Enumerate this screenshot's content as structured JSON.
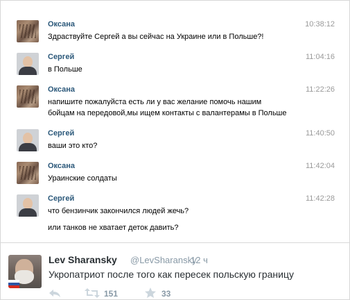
{
  "messages": [
    {
      "sender": "Оксана",
      "time": "10:38:12",
      "lines": [
        "Здраствуйте Сергей а вы сейчас на Украине или в Польше?!"
      ],
      "avatar": "oksana"
    },
    {
      "sender": "Сергей",
      "time": "11:04:16",
      "lines": [
        "в Польше"
      ],
      "avatar": "sergey"
    },
    {
      "sender": "Оксана",
      "time": "11:22:26",
      "lines": [
        "напишите пожалуйста есть ли у вас желание помочь нашим",
        "бойцам на передовой,мы ищем контакты с валантерамы в Польше"
      ],
      "avatar": "oksana"
    },
    {
      "sender": "Сергей",
      "time": "11:40:50",
      "lines": [
        "ваши это кто?"
      ],
      "avatar": "sergey"
    },
    {
      "sender": "Оксана",
      "time": "11:42:04",
      "lines": [
        "Ураинские солдаты"
      ],
      "avatar": "oksana"
    },
    {
      "sender": "Сергей",
      "time": "11:42:28",
      "lines": [
        "что бензинчик закончился людей жечь?"
      ],
      "avatar": "sergey"
    }
  ],
  "followup": "или танков не хватает деток давить?",
  "tweet": {
    "name": "Lev Sharansky",
    "handle": "@LevSharansky",
    "separator": "·",
    "time": "12 ч",
    "text": "Укропатриот после того как пересек польскую границу",
    "retweets": "151",
    "favorites": "33",
    "icons": {
      "reply": "reply-icon",
      "retweet": "retweet-icon",
      "favorite": "star-icon"
    }
  }
}
